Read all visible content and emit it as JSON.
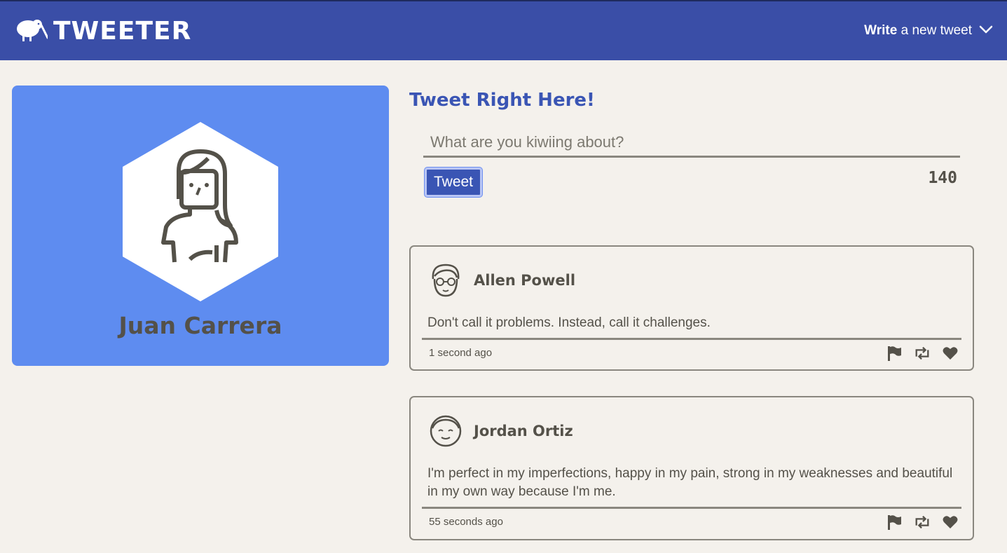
{
  "nav": {
    "brand": "TWEETER",
    "compose_bold": "Write",
    "compose_rest": "a new tweet"
  },
  "profile": {
    "name": "Juan Carrera"
  },
  "compose": {
    "title": "Tweet Right Here!",
    "placeholder": "What are you kiwiing about?",
    "value": "",
    "button_label": "Tweet",
    "counter": "140"
  },
  "tweets": [
    {
      "author": "Allen Powell",
      "text": "Don't call it problems. Instead, call it challenges.",
      "time": "1 second ago",
      "avatar_icon": "glasses-face-icon"
    },
    {
      "author": "Jordan Ortiz",
      "text": "I'm perfect in my imperfections, happy in my pain, strong in my weaknesses and beautiful in my own way because I'm me.",
      "time": "55 seconds ago",
      "avatar_icon": "smiling-face-icon"
    }
  ],
  "icons": {
    "logo": "kiwi-bird-icon",
    "dropdown": "chevron-down-icon",
    "flag": "flag-icon",
    "retweet": "retweet-icon",
    "like": "heart-icon",
    "profile_avatar": "woman-avatar-icon"
  },
  "colors": {
    "nav_bg": "#3a4ea7",
    "accent": "#3a55b4",
    "profile_bg": "#5e8cf0",
    "page_bg": "#f4f1ec",
    "text": "#545149"
  }
}
